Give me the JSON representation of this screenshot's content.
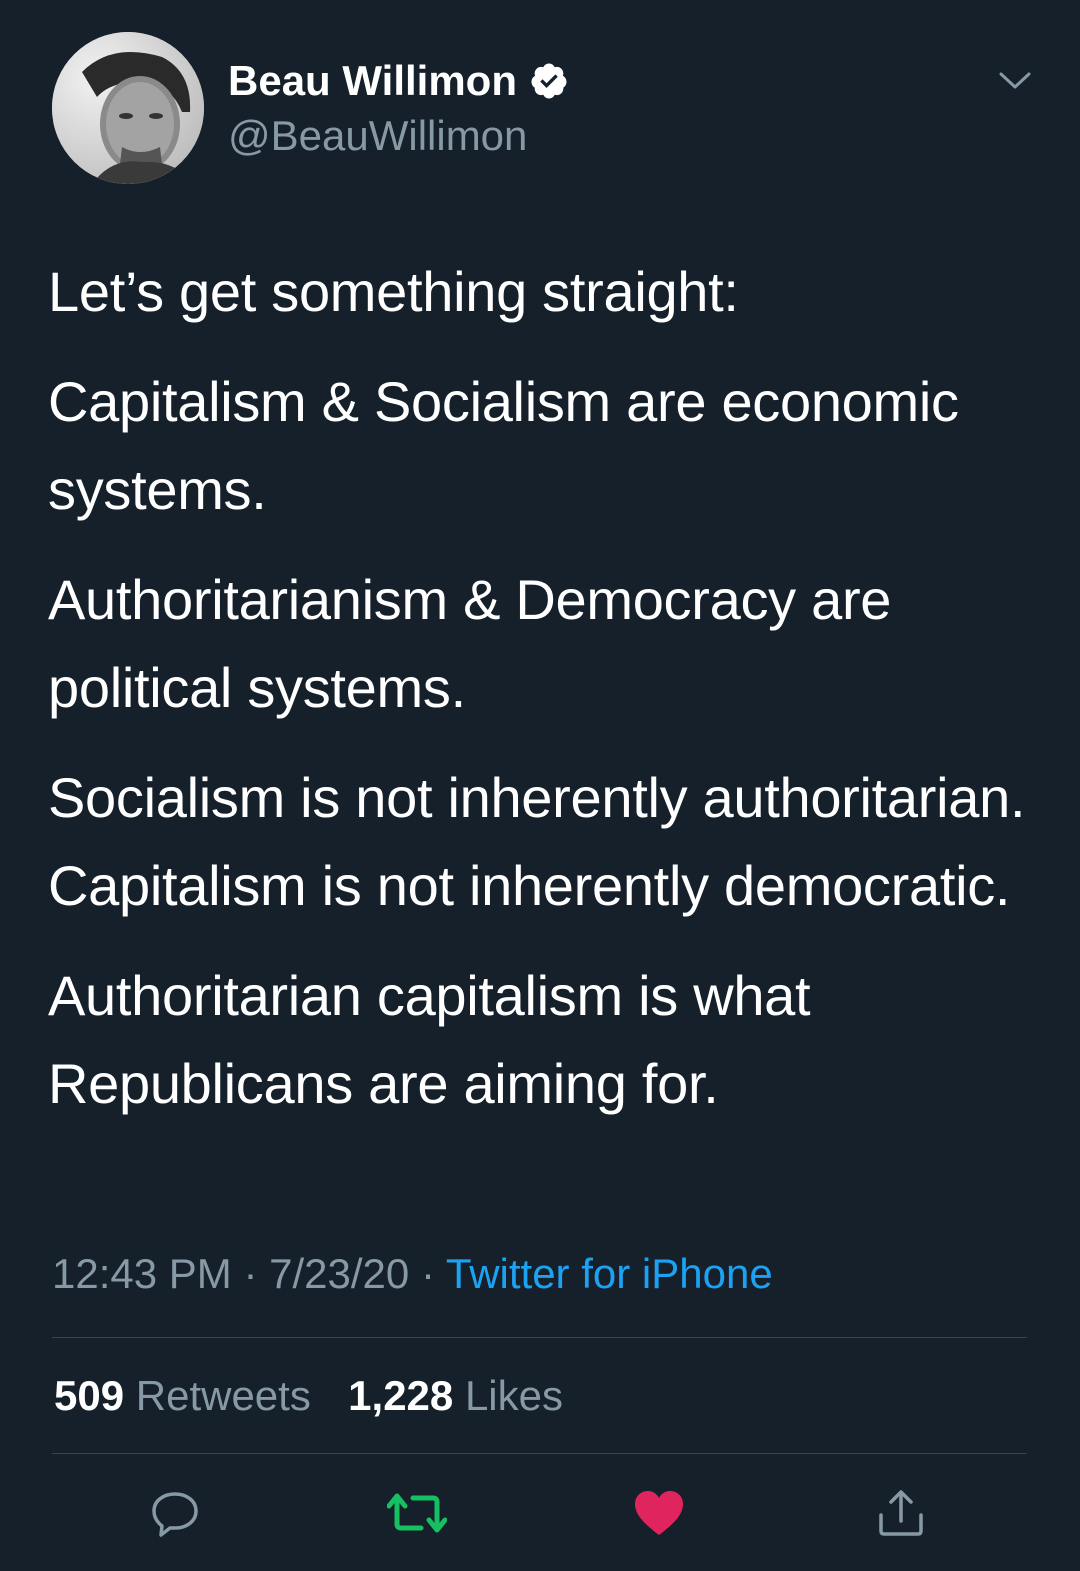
{
  "user": {
    "display_name": "Beau Willimon",
    "handle": "@BeauWillimon",
    "verified": true
  },
  "tweet": {
    "paragraphs": [
      "Let’s get something straight:",
      "Capitalism & Socialism are economic systems.",
      "Authoritarianism & Democracy are political systems.",
      "Socialism is not inherently authoritarian. Capitalism is not inherently democratic.",
      "Authoritarian capitalism is what Republicans are aiming for."
    ],
    "time": "12:43 PM",
    "date": "7/23/20",
    "separator": "·",
    "source": "Twitter for iPhone"
  },
  "stats": {
    "retweets_count": "509",
    "retweets_label": "Retweets",
    "likes_count": "1,228",
    "likes_label": "Likes"
  },
  "icons": {
    "reply": "reply-icon",
    "retweet": "retweet-icon",
    "like": "heart-icon",
    "share": "share-icon",
    "menu": "chevron-down-icon",
    "verified": "verified-badge-icon"
  },
  "colors": {
    "background": "#15202b",
    "text": "#ffffff",
    "secondary_text": "#8899a6",
    "link": "#1da1f2",
    "retweet_active": "#17bf63",
    "like_active": "#e0245e",
    "divider": "#38444d"
  }
}
